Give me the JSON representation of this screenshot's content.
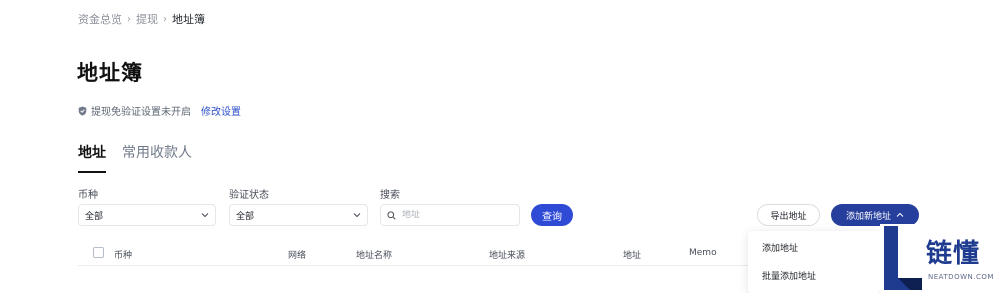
{
  "breadcrumb": {
    "item1": "资金总览",
    "item2": "提现",
    "current": "地址簿"
  },
  "page": {
    "title": "地址簿"
  },
  "verify": {
    "text": "提现免验证设置未开启",
    "edit_link": "修改设置"
  },
  "tabs": [
    {
      "label": "地址"
    },
    {
      "label": "常用收款人"
    }
  ],
  "filters": {
    "currency": {
      "label": "币种",
      "value": "全部"
    },
    "status": {
      "label": "验证状态",
      "value": "全部"
    },
    "search": {
      "label": "搜索",
      "placeholder": "地址"
    },
    "query_button": "查询"
  },
  "actions": {
    "export": "导出地址",
    "add": "添加新地址"
  },
  "table": {
    "columns": [
      "币种",
      "网络",
      "地址名称",
      "地址来源",
      "地址",
      "Memo"
    ]
  },
  "dropdown": {
    "items": [
      "添加地址",
      "批量添加地址"
    ]
  },
  "watermark": {
    "cn": "链懂",
    "en": "NEATDOWN.COM"
  },
  "colors": {
    "primary": "#2f4bd6",
    "primary_dark": "#263f9d",
    "link": "#2b4ec8"
  }
}
